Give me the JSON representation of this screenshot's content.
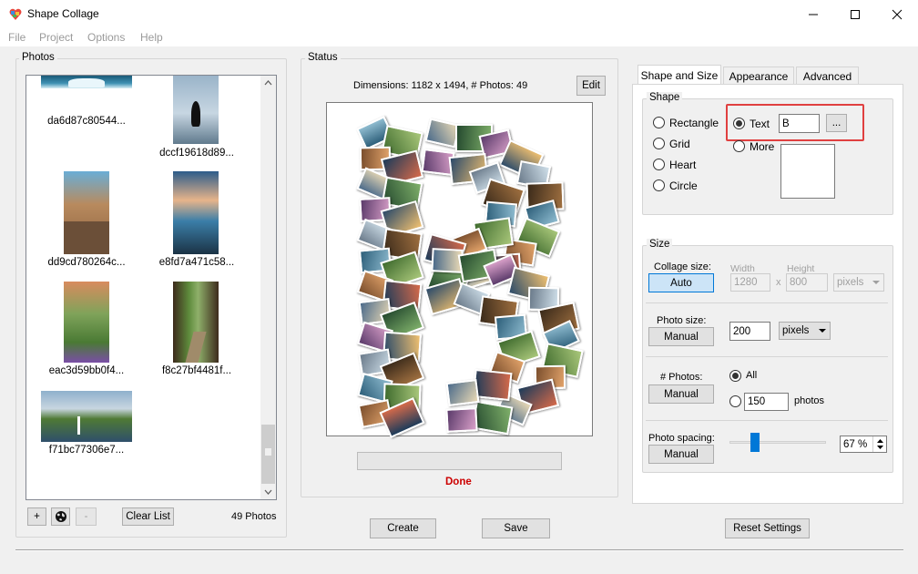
{
  "window": {
    "title": "Shape Collage",
    "icons": {
      "app": "shape-collage-logo-icon",
      "minimize": "minimize-icon",
      "maximize": "maximize-icon",
      "close": "close-icon"
    }
  },
  "menu": {
    "items": [
      "File",
      "Project",
      "Options",
      "Help"
    ]
  },
  "photos_panel": {
    "title": "Photos",
    "thumbnails": [
      {
        "name": "da6d87c80544..."
      },
      {
        "name": "dccf19618d89..."
      },
      {
        "name": "dd9cd780264c..."
      },
      {
        "name": "e8fd7a471c58..."
      },
      {
        "name": "eac3d59bb0f4..."
      },
      {
        "name": "f8c27bf4481f..."
      },
      {
        "name": "f71bc77306e7..."
      }
    ],
    "add_label": "+",
    "web_icon": "globe-icon",
    "remove_label": "-",
    "clear_label": "Clear List",
    "count": "49 Photos"
  },
  "status_panel": {
    "title": "Status",
    "dimensions": "Dimensions: 1182 x 1494, # Photos: 49",
    "edit_label": "Edit",
    "progress": 0,
    "status_text": "Done",
    "status_color": "#cc0000"
  },
  "actions": {
    "create": "Create",
    "save": "Save",
    "reset": "Reset Settings"
  },
  "settings": {
    "tabs": [
      "Shape and Size",
      "Appearance",
      "Advanced"
    ],
    "active_tab": "Shape and Size",
    "shape": {
      "title": "Shape",
      "options": [
        "Rectangle",
        "Grid",
        "Heart",
        "Circle",
        "Text",
        "More"
      ],
      "selected": "Text",
      "text_value": "B",
      "browse_label": "...",
      "highlight_color": "#e04040"
    },
    "size": {
      "title": "Size",
      "collage_size_label": "Collage size:",
      "collage_size_mode": "Auto",
      "width_label": "Width",
      "height_label": "Height",
      "width": "1280",
      "height": "800",
      "x_label": "x",
      "collage_unit": "pixels",
      "photo_size_label": "Photo size:",
      "photo_size_mode": "Manual",
      "photo_size": "200",
      "photo_unit": "pixels",
      "num_photos_label": "# Photos:",
      "num_photos_mode": "Manual",
      "all_label": "All",
      "num_photos_value": "150",
      "photos_label": "photos",
      "spacing_label": "Photo spacing:",
      "spacing_mode": "Manual",
      "spacing_value": "67 %",
      "spacing_slider": 0.04
    }
  }
}
